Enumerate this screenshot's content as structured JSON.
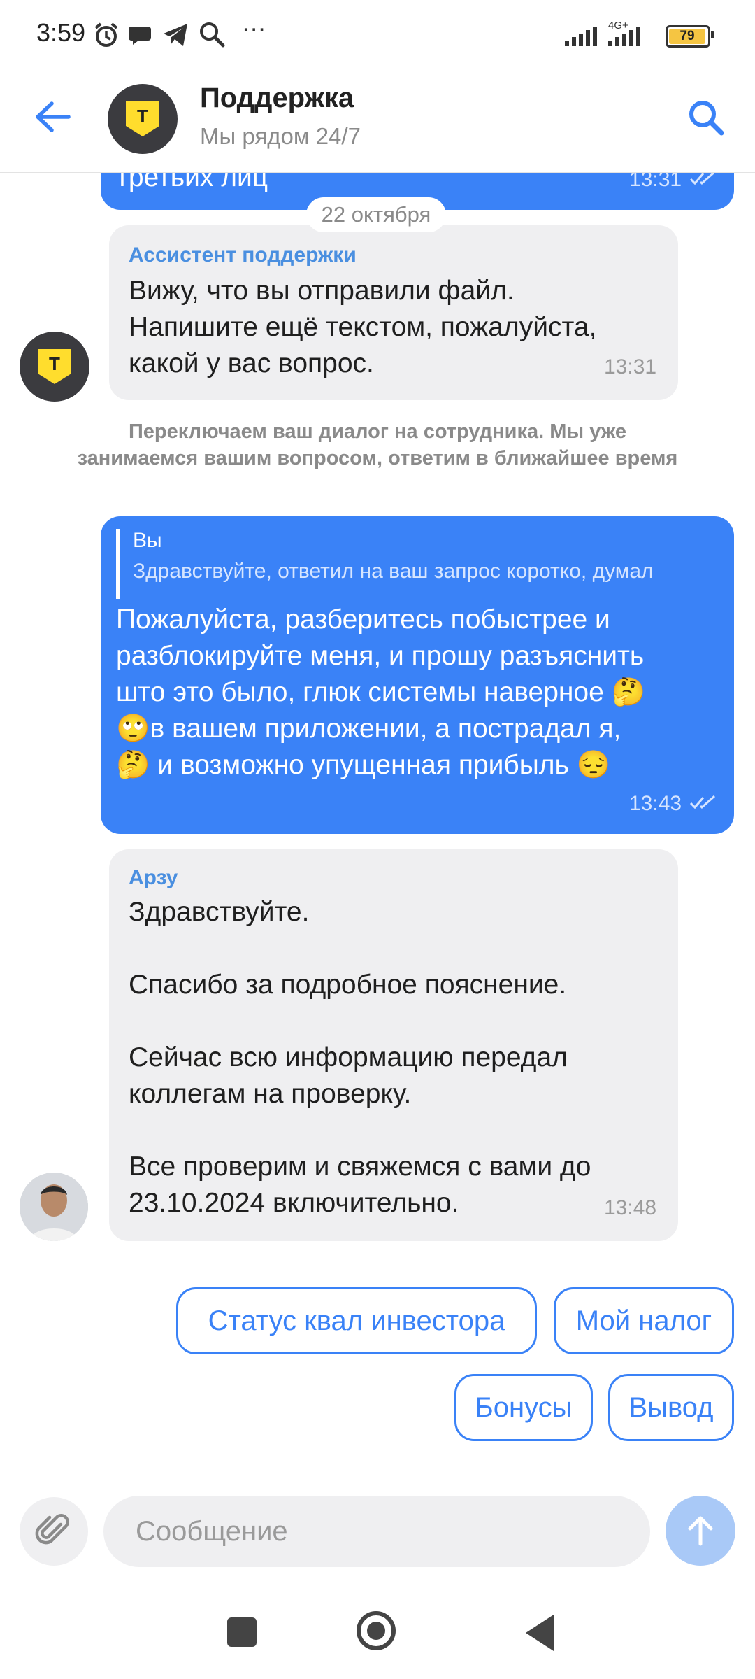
{
  "status_bar": {
    "time": "3:59",
    "network_label": "4G+",
    "battery": "79",
    "icons": [
      "alarm-icon",
      "chat-bubble-icon",
      "telegram-icon",
      "search-icon",
      "more-icon"
    ]
  },
  "header": {
    "back_icon": "back-arrow-icon",
    "title": "Поддержка",
    "subtitle": "Мы рядом 24/7",
    "search_icon": "search-icon",
    "avatar_letter": "Т"
  },
  "messages": {
    "top_fragment": {
      "text": "третьих лиц",
      "time": "13:31"
    },
    "date_separator": "22 октября",
    "assistant_msg": {
      "sender": "Ассистент поддержки",
      "text": "Вижу, что вы отправили файл.\nНапишите ещё текстом, пожалуйста,\nкакой у вас вопрос.",
      "time": "13:31"
    },
    "system_note": "Переключаем ваш диалог на сотрудника. Мы уже занимаемся вашим вопросом, ответим в ближайшее время",
    "user_msg": {
      "quote_name": "Вы",
      "quote_text": "Здравствуйте, ответил на ваш запрос коротко, думал",
      "text": "Пожалуйста, разберитесь побыстрее и\nразблокируйте меня, и прошу разъяснить\nшто это было, глюк системы наверное 🤔\n🙄в вашем приложении, а пострадал я,\n🤔 и возможно упущенная прибыль 😔",
      "time": "13:43"
    },
    "agent_msg": {
      "sender": "Арзу",
      "text": "Здравствуйте.\n\nСпасибо за подробное пояснение.\n\nСейчас всю информацию передал\nколлегам на проверку.\n\nВсе проверим и свяжемся с вами до\n23.10.2024 включительно.",
      "time": "13:48"
    }
  },
  "quick_replies": [
    "Статус квал инвестора",
    "Мой налог",
    "Бонусы",
    "Вывод"
  ],
  "composer": {
    "placeholder": "Сообщение"
  },
  "colors": {
    "accent": "#3a82f7",
    "incoming_bg": "#efeff1",
    "brand_yellow": "#ffdd2d"
  }
}
